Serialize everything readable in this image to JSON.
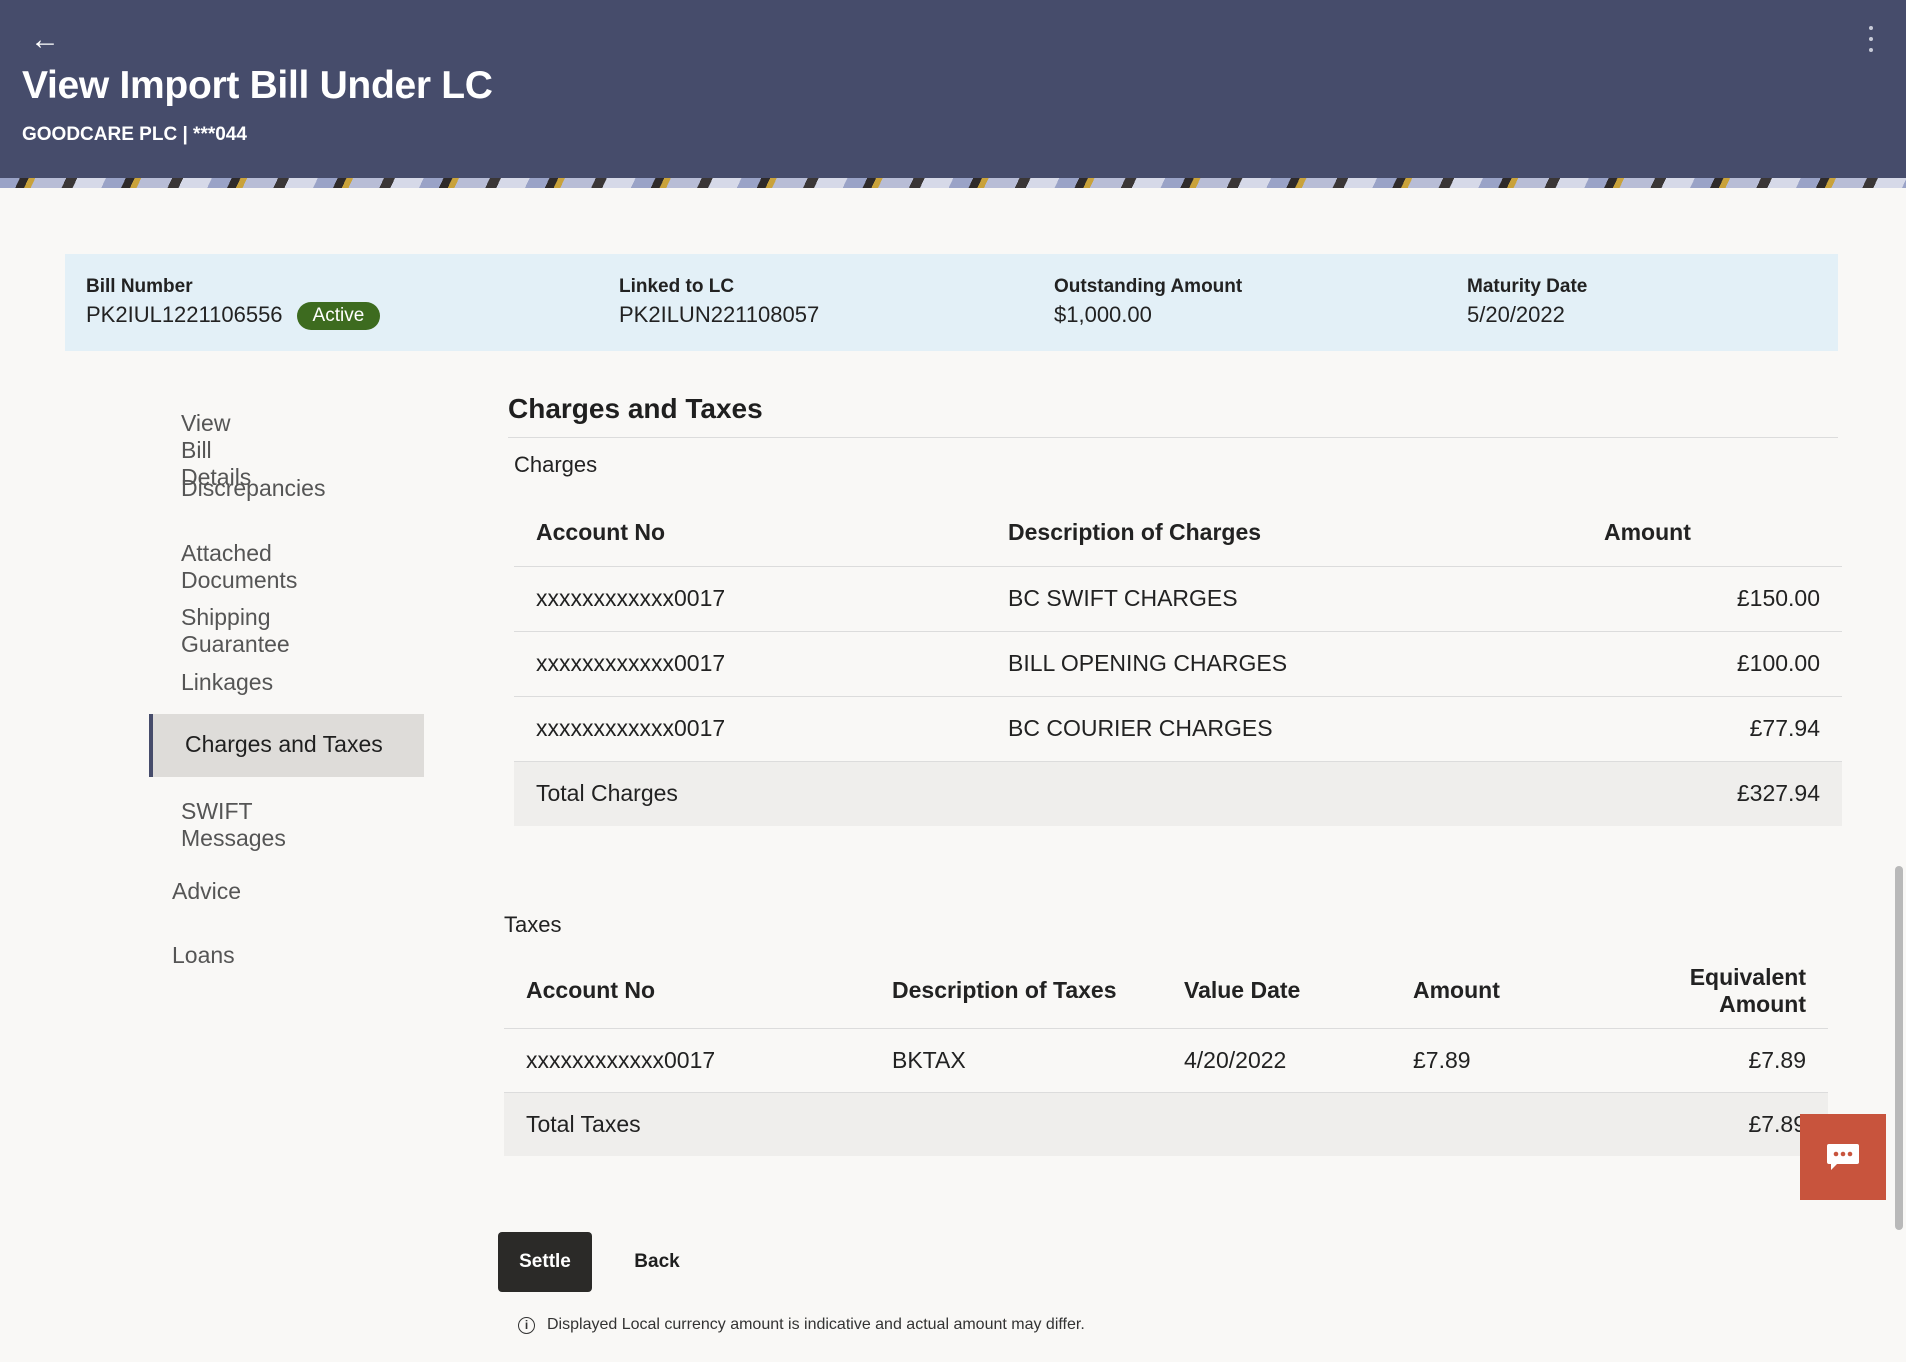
{
  "header": {
    "title": "View Import Bill Under LC",
    "subtitle": "GOODCARE PLC | ***044"
  },
  "summary": {
    "bill_number_label": "Bill Number",
    "bill_number": "PK2IUL1221106556",
    "status": "Active",
    "linked_lc_label": "Linked to LC",
    "linked_lc": "PK2ILUN221108057",
    "outstanding_label": "Outstanding Amount",
    "outstanding": "$1,000.00",
    "maturity_label": "Maturity Date",
    "maturity": "5/20/2022"
  },
  "nav": {
    "items": [
      "View Bill Details",
      "Discrepancies",
      "Attached Documents",
      "Shipping Guarantee",
      "Linkages",
      "Charges and Taxes",
      "SWIFT Messages"
    ],
    "extra": [
      "Advice",
      "Loans"
    ]
  },
  "content": {
    "section_title": "Charges and Taxes",
    "charges_title": "Charges",
    "charges_headers": [
      "Account No",
      "Description of Charges",
      "Amount"
    ],
    "charges_rows": [
      [
        "xxxxxxxxxxxx0017",
        "BC SWIFT CHARGES",
        "£150.00"
      ],
      [
        "xxxxxxxxxxxx0017",
        "BILL OPENING CHARGES",
        "£100.00"
      ],
      [
        "xxxxxxxxxxxx0017",
        "BC COURIER CHARGES",
        "£77.94"
      ]
    ],
    "charges_total_label": "Total Charges",
    "charges_total": "£327.94",
    "taxes_title": "Taxes",
    "taxes_headers": [
      "Account No",
      "Description of Taxes",
      "Value Date",
      "Amount",
      "Equivalent",
      "Amount"
    ],
    "taxes_rows": [
      [
        "xxxxxxxxxxxx0017",
        "BKTAX",
        "4/20/2022",
        "£7.89",
        "£7.89"
      ]
    ],
    "taxes_total_label": "Total Taxes",
    "taxes_total": "£7.89"
  },
  "actions": {
    "settle": "Settle",
    "back": "Back"
  },
  "disclaimer": "Displayed Local currency amount is indicative and actual amount may differ.",
  "colors": {
    "header_bg": "#464c6b",
    "badge_bg": "#3d6b1f",
    "chat_bg": "#c8543d",
    "summary_bg": "#e3f0f7"
  }
}
